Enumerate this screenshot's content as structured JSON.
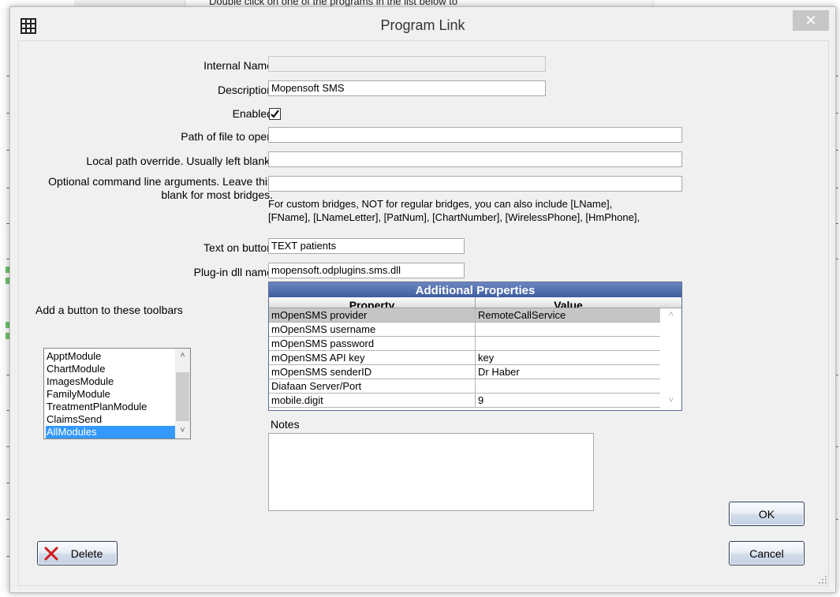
{
  "background": {
    "partial_text": "Double click on one of the programs in the list below to"
  },
  "dialog": {
    "title": "Program Link",
    "close_glyph": "✕",
    "app_icon": "grid-icon"
  },
  "form": {
    "internal_name_label": "Internal Name",
    "internal_name_value": "",
    "description_label": "Description",
    "description_value": "Mopensoft SMS",
    "enabled_label": "Enabled",
    "enabled_checked": true,
    "path_label": "Path of file to open",
    "path_value": "",
    "local_path_label": "Local path override.  Usually left blank.",
    "local_path_value": "",
    "args_label_line1": "Optional command line arguments.  Leave this",
    "args_label_line2": "blank for most bridges.",
    "args_value": "",
    "custom_hint_line1": "For custom bridges, NOT for regular bridges, you can also include [LName],",
    "custom_hint_line2": "[FName], [LNameLetter], [PatNum], [ChartNumber], [WirelessPhone], [HmPhone],",
    "button_text_label": "Text on button",
    "button_text_value": "TEXT patients",
    "plugin_label": "Plug-in dll name",
    "plugin_value": "mopensoft.odplugins.sms.dll"
  },
  "toolbars": {
    "label": "Add a button to these toolbars",
    "items": [
      "ApptModule",
      "ChartModule",
      "ImagesModule",
      "FamilyModule",
      "TreatmentPlanModule",
      "ClaimsSend",
      "AllModules"
    ],
    "selected": "AllModules"
  },
  "properties": {
    "title": "Additional Properties",
    "col_property": "Property",
    "col_value": "Value",
    "rows": [
      {
        "property": "mOpenSMS provider",
        "value": "RemoteCallService"
      },
      {
        "property": "mOpenSMS username",
        "value": ""
      },
      {
        "property": "mOpenSMS password",
        "value": ""
      },
      {
        "property": "mOpenSMS API key",
        "value": "key"
      },
      {
        "property": "mOpenSMS senderID",
        "value": "Dr Haber"
      },
      {
        "property": "Diafaan Server/Port",
        "value": ""
      },
      {
        "property": "mobile.digit",
        "value": "9"
      }
    ],
    "selected_index": 0
  },
  "notes": {
    "label": "Notes",
    "value": ""
  },
  "buttons": {
    "ok": "OK",
    "cancel": "Cancel",
    "delete": "Delete"
  },
  "colors": {
    "accent_selection": "#3399ff",
    "grid_header": "#4a67a8",
    "delete_icon": "#d11a1a"
  }
}
